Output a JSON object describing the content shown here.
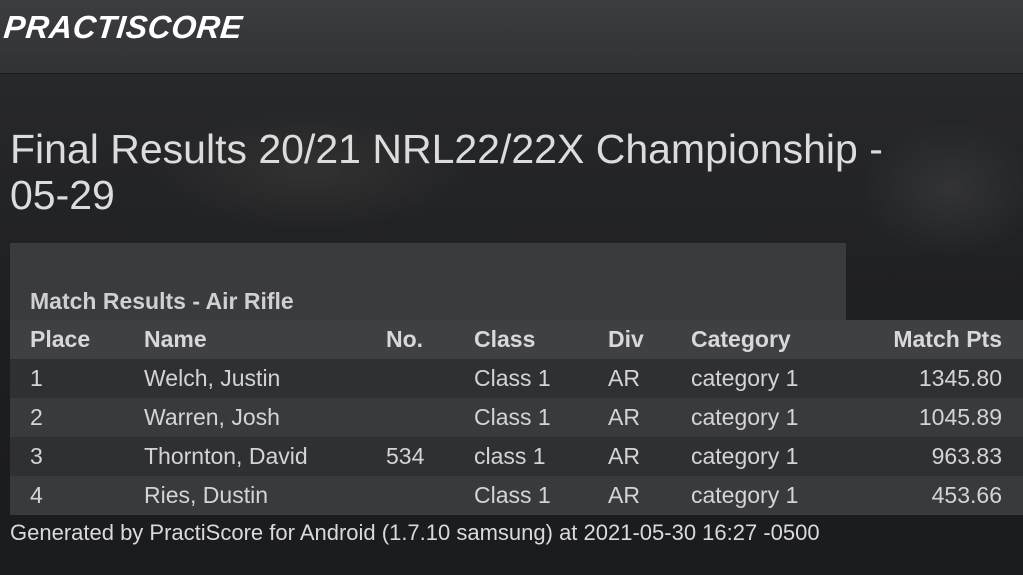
{
  "app": {
    "logo_text": "PRACTISCORE"
  },
  "title": {
    "line1": "Final Results 20/21 NRL22/22X Championship -",
    "line2": "05-29"
  },
  "results": {
    "section_title": "Match Results - Air Rifle",
    "columns": [
      "Place",
      "Name",
      "No.",
      "Class",
      "Div",
      "Category",
      "Match Pts"
    ],
    "rows": [
      {
        "place": "1",
        "name": "Welch, Justin",
        "no": "",
        "class": "Class 1",
        "div": "AR",
        "category": "category 1",
        "pts": "1345.80"
      },
      {
        "place": "2",
        "name": "Warren, Josh",
        "no": "",
        "class": "Class 1",
        "div": "AR",
        "category": "category 1",
        "pts": "1045.89"
      },
      {
        "place": "3",
        "name": "Thornton, David",
        "no": "534",
        "class": "class 1",
        "div": "AR",
        "category": "category 1",
        "pts": "963.83"
      },
      {
        "place": "4",
        "name": "Ries, Dustin",
        "no": "",
        "class": "Class 1",
        "div": "AR",
        "category": "category 1",
        "pts": "453.66"
      }
    ]
  },
  "footer": {
    "text": "Generated by PractiScore for Android (1.7.10 samsung) at 2021-05-30 16:27 -0500"
  }
}
